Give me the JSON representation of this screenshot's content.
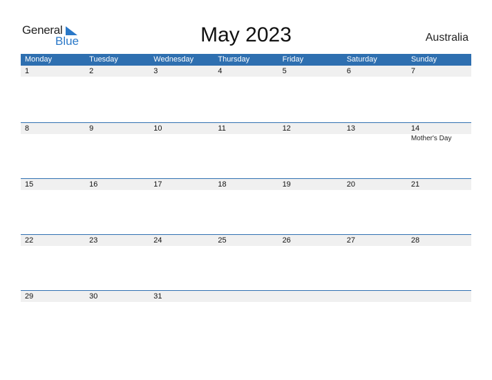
{
  "logo": {
    "word1": "General",
    "word2": "Blue",
    "icon": "triangle-flag-icon"
  },
  "title": "May 2023",
  "country": "Australia",
  "colors": {
    "header": "#2e6fb0",
    "strip": "#f0f0f0",
    "brand": "#2a78c8"
  },
  "weekdays": [
    "Monday",
    "Tuesday",
    "Wednesday",
    "Thursday",
    "Friday",
    "Saturday",
    "Sunday"
  ],
  "weeks": [
    {
      "days": [
        "1",
        "2",
        "3",
        "4",
        "5",
        "6",
        "7"
      ],
      "events": [
        "",
        "",
        "",
        "",
        "",
        "",
        ""
      ]
    },
    {
      "days": [
        "8",
        "9",
        "10",
        "11",
        "12",
        "13",
        "14"
      ],
      "events": [
        "",
        "",
        "",
        "",
        "",
        "",
        "Mother's Day"
      ]
    },
    {
      "days": [
        "15",
        "16",
        "17",
        "18",
        "19",
        "20",
        "21"
      ],
      "events": [
        "",
        "",
        "",
        "",
        "",
        "",
        ""
      ]
    },
    {
      "days": [
        "22",
        "23",
        "24",
        "25",
        "26",
        "27",
        "28"
      ],
      "events": [
        "",
        "",
        "",
        "",
        "",
        "",
        ""
      ]
    },
    {
      "days": [
        "29",
        "30",
        "31",
        "",
        "",
        "",
        ""
      ],
      "events": [
        "",
        "",
        "",
        "",
        "",
        "",
        ""
      ]
    }
  ]
}
